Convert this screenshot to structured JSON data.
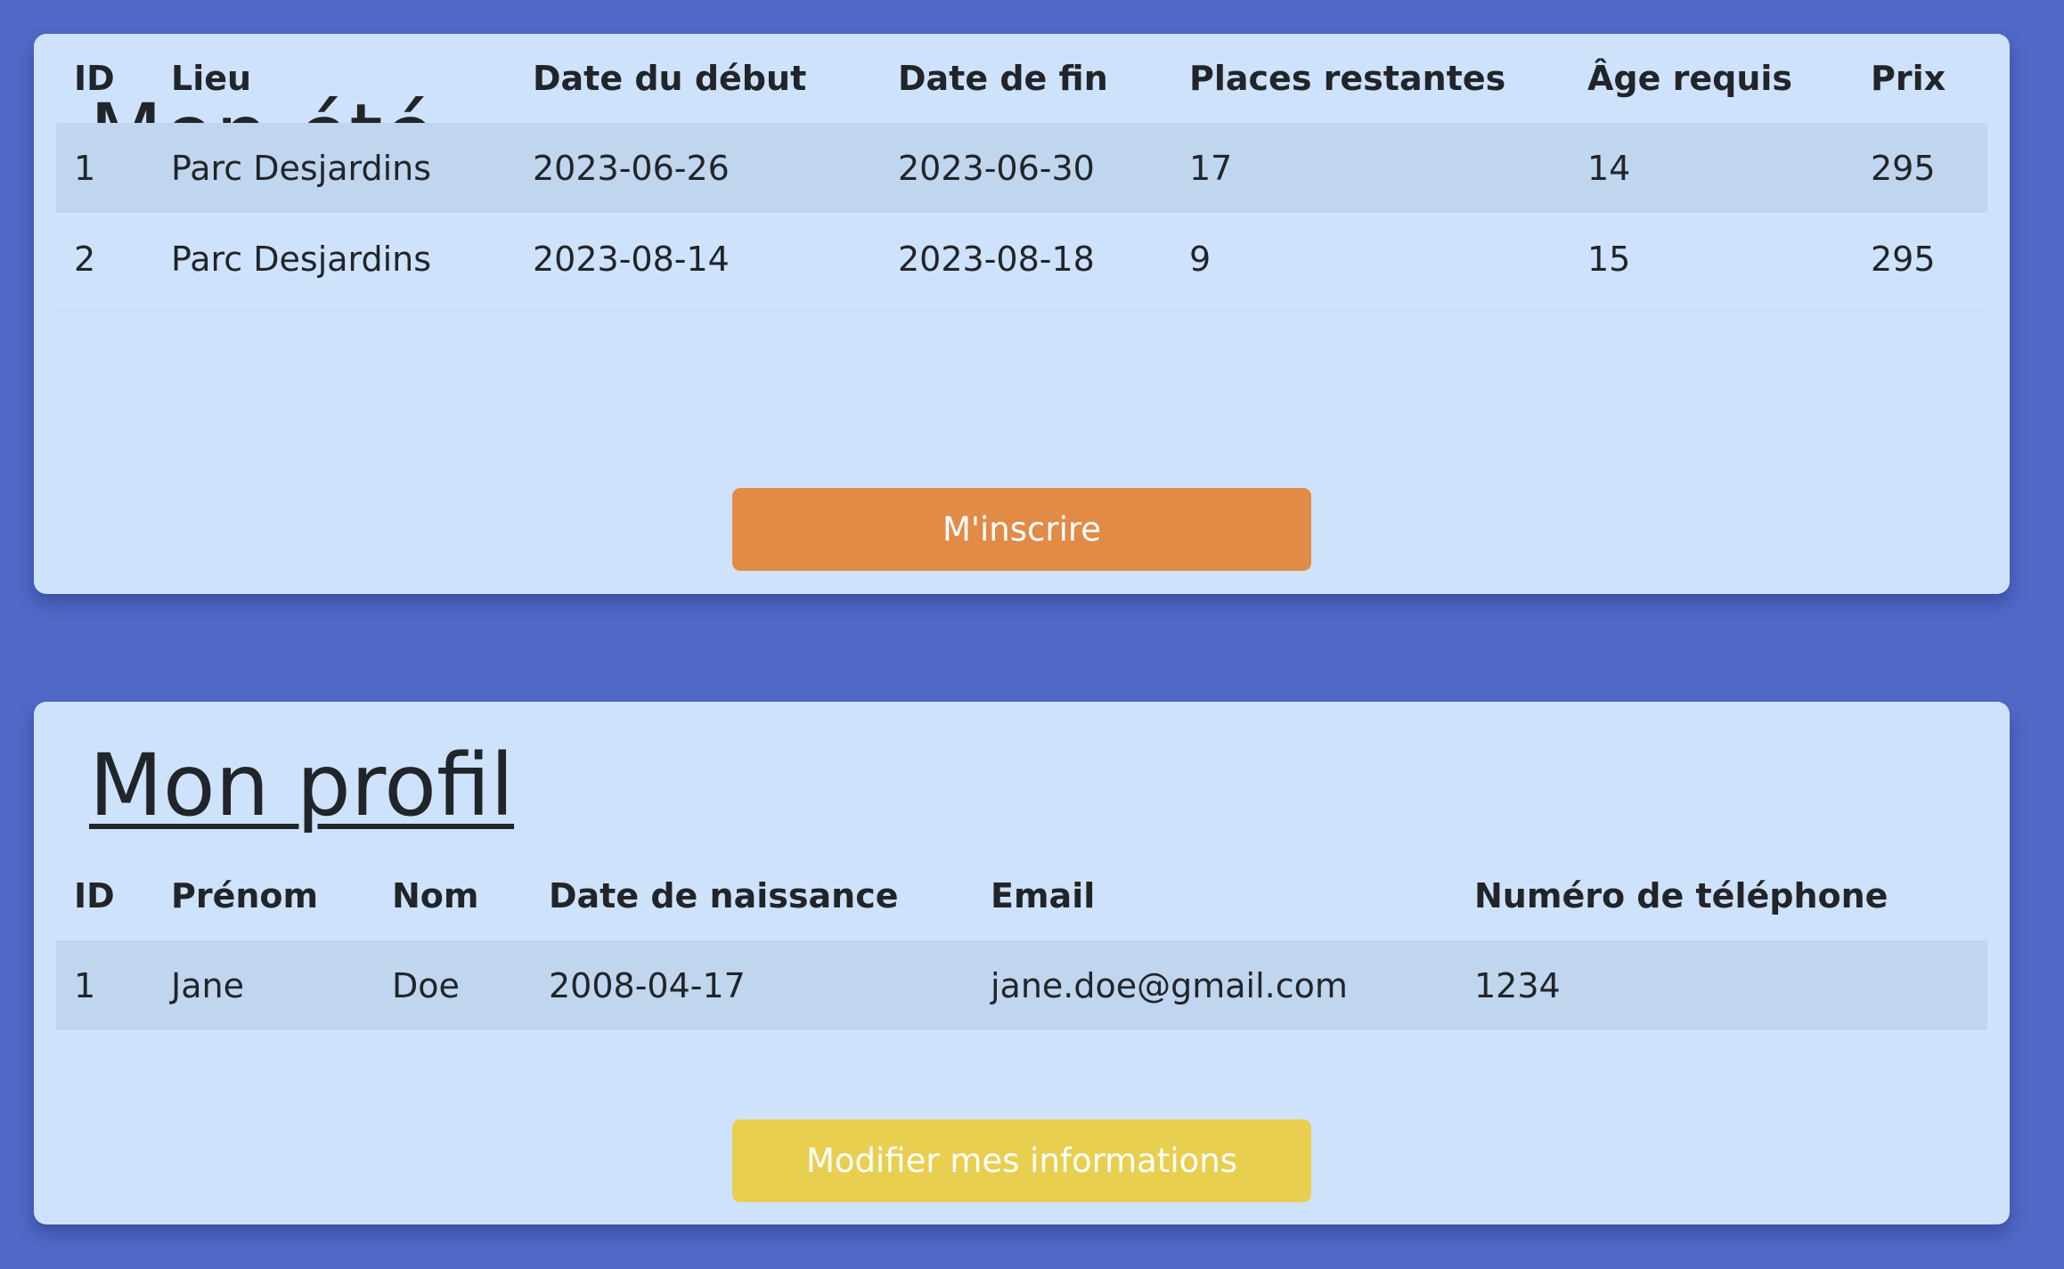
{
  "colors": {
    "page_background": "#5069c7",
    "card_background": "#cfe2fb",
    "row_stripe": "#c0d5ee",
    "register_button": "#e18b47",
    "edit_button": "#e8cf4f"
  },
  "summer": {
    "title": "Mon été",
    "columns": [
      "ID",
      "Lieu",
      "Date du début",
      "Date de fin",
      "Places restantes",
      "Âge requis",
      "Prix"
    ],
    "rows": [
      [
        "1",
        "Parc Desjardins",
        "2023-06-26",
        "2023-06-30",
        "17",
        "14",
        "295"
      ],
      [
        "2",
        "Parc Desjardins",
        "2023-08-14",
        "2023-08-18",
        "9",
        "15",
        "295"
      ]
    ],
    "button_label": "M'inscrire"
  },
  "profile": {
    "title": "Mon profil",
    "columns": [
      "ID",
      "Prénom",
      "Nom",
      "Date de naissance",
      "Email",
      "Numéro de téléphone"
    ],
    "rows": [
      [
        "1",
        "Jane",
        "Doe",
        "2008-04-17",
        "jane.doe@gmail.com",
        "1234"
      ]
    ],
    "button_label": "Modifier mes informations"
  }
}
